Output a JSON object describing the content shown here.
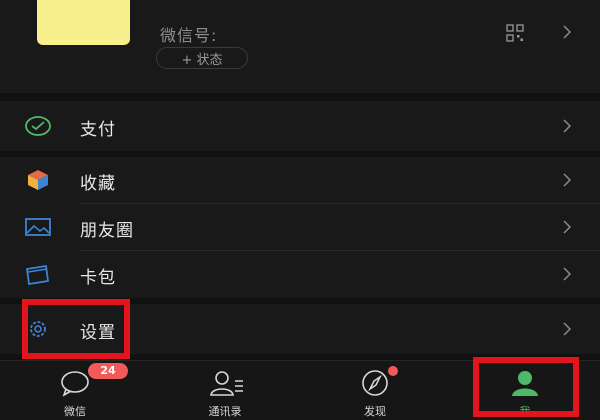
{
  "profile": {
    "wechat_id_label": "微信号:",
    "status_label": "+ 状态"
  },
  "menu": {
    "pay": "支付",
    "favorites": "收藏",
    "moments": "朋友圈",
    "cards": "卡包",
    "settings": "设置"
  },
  "tabbar": {
    "chats": "微信",
    "chats_badge": "24",
    "contacts": "通讯录",
    "discover": "发现",
    "me": "我"
  },
  "colors": {
    "accent_green": "#4fb96a",
    "highlight_red": "#e3141b",
    "badge_red": "#f25a5a"
  }
}
